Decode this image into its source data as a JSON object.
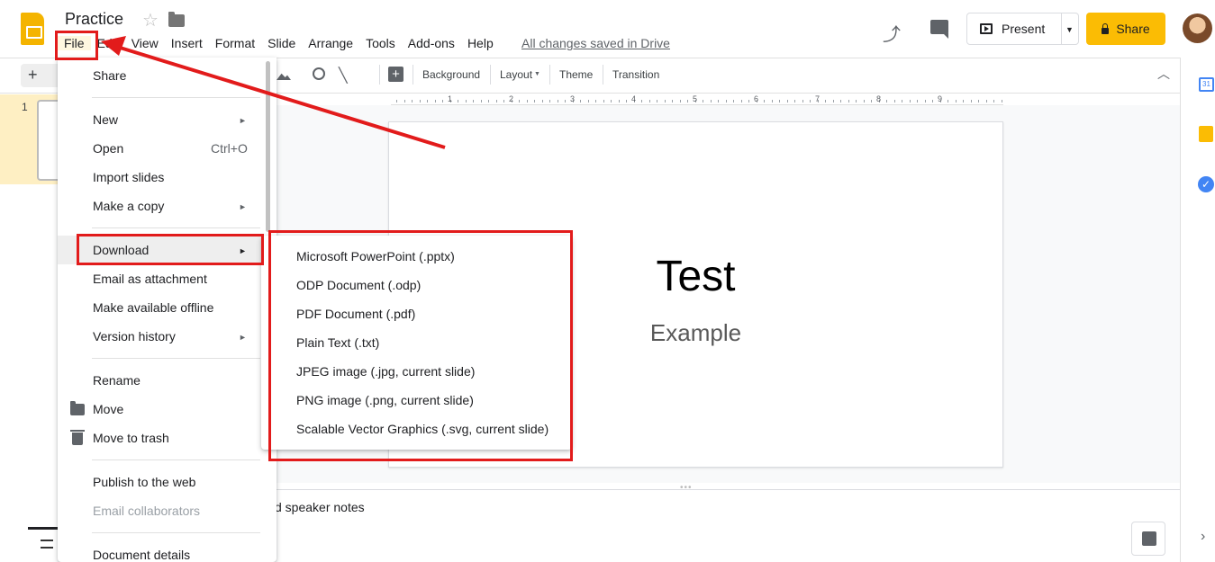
{
  "header": {
    "title": "Practice",
    "saved_status": "All changes saved in Drive",
    "present_label": "Present",
    "share_label": "Share"
  },
  "menubar": [
    "File",
    "Edit",
    "View",
    "Insert",
    "Format",
    "Slide",
    "Arrange",
    "Tools",
    "Add-ons",
    "Help"
  ],
  "toolbar": {
    "new_label": "+",
    "labels": [
      "Background",
      "Layout",
      "Theme",
      "Transition"
    ]
  },
  "ruler": [
    "1",
    "2",
    "3",
    "4",
    "5",
    "6",
    "7",
    "8",
    "9"
  ],
  "filmstrip": {
    "slide_number": "1"
  },
  "slide": {
    "title": "Test",
    "subtitle": "Example"
  },
  "notes": {
    "placeholder": "d speaker notes"
  },
  "sidebar": {
    "calendar_label": "31"
  },
  "file_menu": {
    "items": [
      {
        "label": "Share"
      },
      {
        "label": "New",
        "submenu": true
      },
      {
        "label": "Open",
        "shortcut": "Ctrl+O"
      },
      {
        "label": "Import slides"
      },
      {
        "label": "Make a copy",
        "submenu": true
      },
      {
        "label": "Download",
        "submenu": true,
        "highlighted": true
      },
      {
        "label": "Email as attachment"
      },
      {
        "label": "Make available offline"
      },
      {
        "label": "Version history",
        "submenu": true
      },
      {
        "label": "Rename"
      },
      {
        "label": "Move",
        "icon": "folder-icon"
      },
      {
        "label": "Move to trash",
        "icon": "trash-icon"
      },
      {
        "label": "Publish to the web"
      },
      {
        "label": "Email collaborators",
        "disabled": true
      },
      {
        "label": "Document details"
      }
    ]
  },
  "download_submenu": [
    "Microsoft PowerPoint (.pptx)",
    "ODP Document (.odp)",
    "PDF Document (.pdf)",
    "Plain Text (.txt)",
    "JPEG image (.jpg, current slide)",
    "PNG image (.png, current slide)",
    "Scalable Vector Graphics (.svg, current slide)"
  ],
  "colors": {
    "accent": "#fbbc04",
    "annotation_red": "#e21b1b",
    "menu_highlight": "#eeeeee"
  }
}
